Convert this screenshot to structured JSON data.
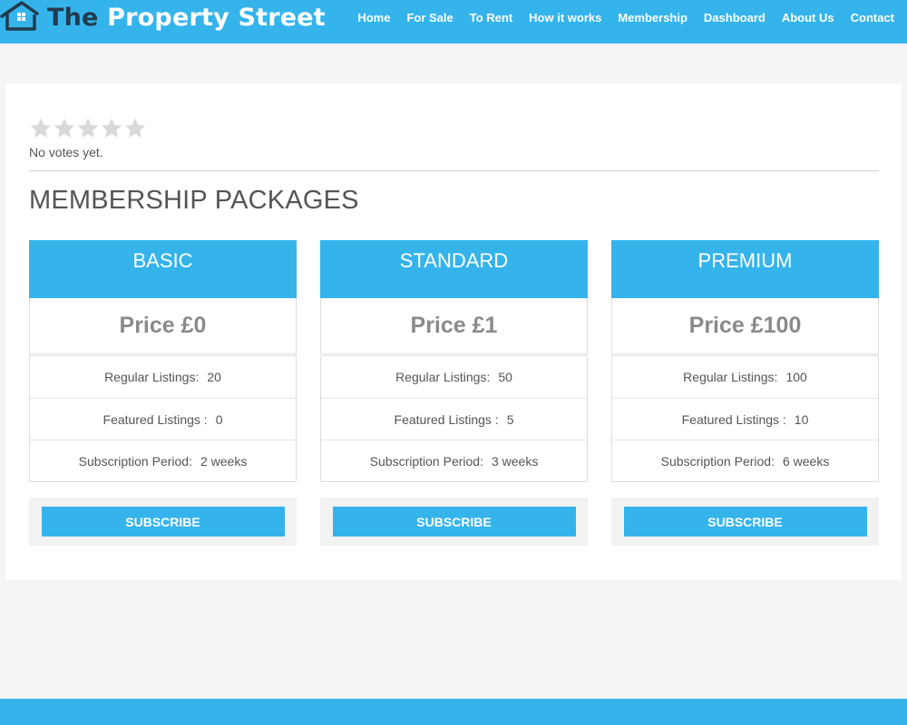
{
  "header": {
    "brand_prefix": "The",
    "brand_rest": "Property Street",
    "nav": [
      "Home",
      "For Sale",
      "To Rent",
      "How it works",
      "Membership",
      "Dashboard",
      "About Us",
      "Contact"
    ]
  },
  "rating": {
    "stars": 5,
    "votes_text": "No votes yet."
  },
  "section_title": "MEMBERSHIP PACKAGES",
  "packages": [
    {
      "name": "BASIC",
      "price": "Price £0",
      "features": [
        {
          "label": "Regular Listings:",
          "value": "20"
        },
        {
          "label": "Featured Listings :",
          "value": "0"
        },
        {
          "label": "Subscription Period:",
          "value": "2 weeks"
        }
      ],
      "button": "SUBSCRIBE"
    },
    {
      "name": "STANDARD",
      "price": "Price £1",
      "features": [
        {
          "label": "Regular Listings:",
          "value": "50"
        },
        {
          "label": "Featured Listings :",
          "value": "5"
        },
        {
          "label": "Subscription Period:",
          "value": "3 weeks"
        }
      ],
      "button": "SUBSCRIBE"
    },
    {
      "name": "PREMIUM",
      "price": "Price £100",
      "features": [
        {
          "label": "Regular Listings:",
          "value": "100"
        },
        {
          "label": "Featured Listings :",
          "value": "10"
        },
        {
          "label": "Subscription Period:",
          "value": "6 weeks"
        }
      ],
      "button": "SUBSCRIBE"
    }
  ],
  "colors": {
    "accent": "#35b4ec",
    "brand_dark": "#223a4d",
    "price_text": "#8a8a8a",
    "star_empty": "#d9d9d9"
  }
}
